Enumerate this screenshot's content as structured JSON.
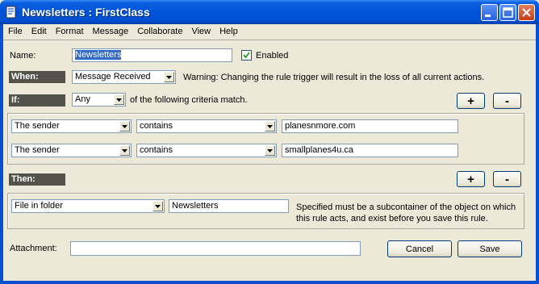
{
  "window": {
    "title": "Newsletters : FirstClass"
  },
  "menu": [
    "File",
    "Edit",
    "Format",
    "Message",
    "Collaborate",
    "View",
    "Help"
  ],
  "name_row": {
    "label": "Name:",
    "value": "Newsletters",
    "enabled_label": "Enabled",
    "enabled": true
  },
  "when_row": {
    "label": "When:",
    "trigger": "Message Received",
    "warning": "Warning:  Changing the rule trigger will result in the loss of all current actions."
  },
  "if_row": {
    "label": "If:",
    "match": "Any",
    "suffix": "of the following criteria match."
  },
  "criteria": [
    {
      "field": "The sender",
      "operator": "contains",
      "value": "planesnmore.com"
    },
    {
      "field": "The sender",
      "operator": "contains",
      "value": "smallplanes4u.ca"
    }
  ],
  "then_row": {
    "label": "Then:"
  },
  "action": {
    "type": "File in folder",
    "value": "Newsletters",
    "note_line1": "Specified must be a subcontainer of the object on which",
    "note_line2": "this rule acts, and  exist before you save this rule."
  },
  "buttons": {
    "add": "+",
    "remove": "-",
    "cancel": "Cancel",
    "save": "Save"
  },
  "attachment": {
    "label": "Attachment:",
    "value": ""
  },
  "colors": {
    "titlebar": "#0053d8",
    "section_label": "#53534b",
    "face": "#ece9d8",
    "selection": "#316ac5"
  }
}
